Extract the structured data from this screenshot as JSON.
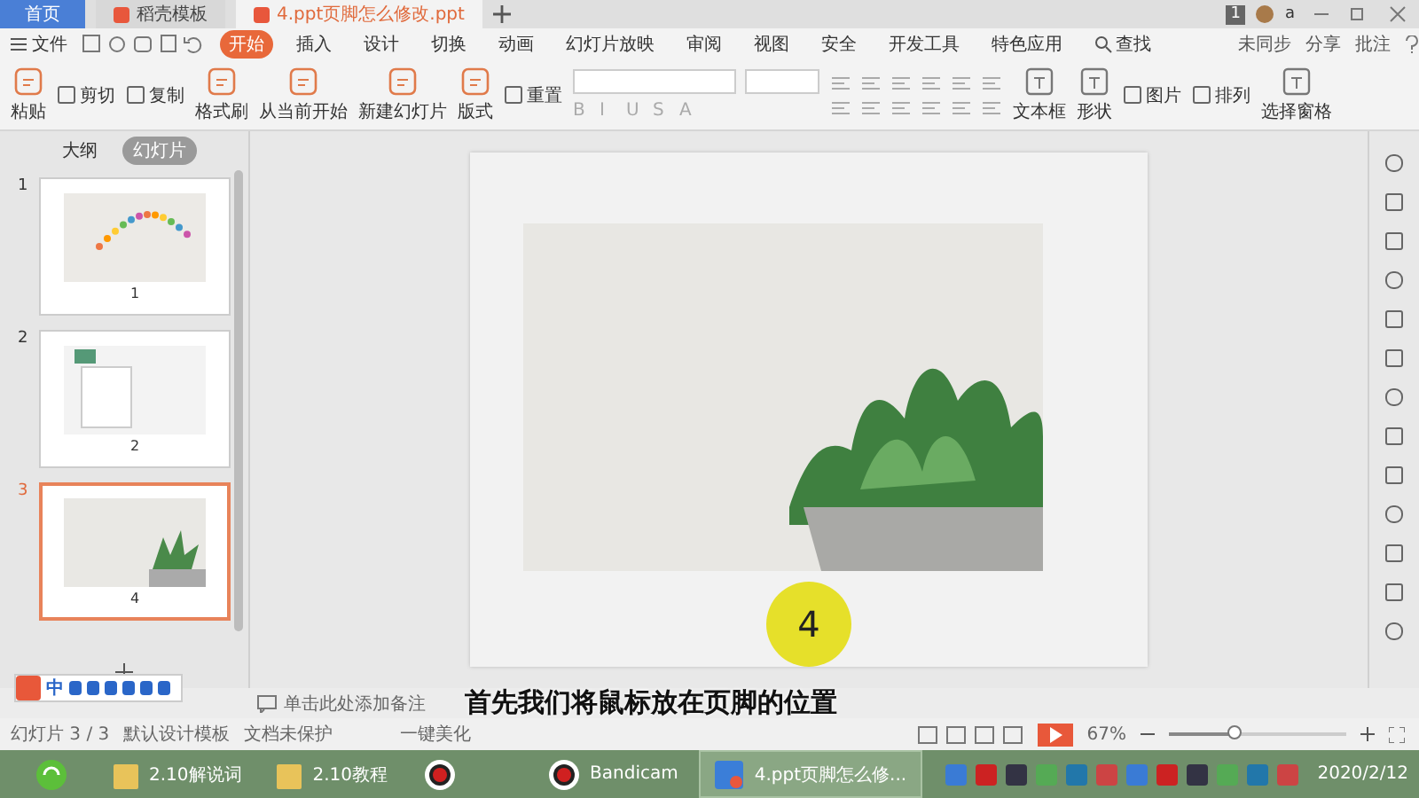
{
  "tabs": [
    {
      "label": "首页",
      "kind": "home",
      "selected": false
    },
    {
      "label": "稻壳模板",
      "kind": "template",
      "selected": false
    },
    {
      "label": "4.ppt页脚怎么修改.ppt",
      "kind": "document",
      "selected": true
    }
  ],
  "title_bar": {
    "badge": "1",
    "user": "a"
  },
  "menu": {
    "file": "文件",
    "items": [
      {
        "label": "开始",
        "selected": true
      },
      {
        "label": "插入",
        "selected": false
      },
      {
        "label": "设计",
        "selected": false
      },
      {
        "label": "切换",
        "selected": false
      },
      {
        "label": "动画",
        "selected": false
      },
      {
        "label": "幻灯片放映",
        "selected": false
      },
      {
        "label": "审阅",
        "selected": false
      },
      {
        "label": "视图",
        "selected": false
      },
      {
        "label": "安全",
        "selected": false
      },
      {
        "label": "开发工具",
        "selected": false
      },
      {
        "label": "特色应用",
        "selected": false
      }
    ],
    "search": "查找",
    "actions": [
      "未同步",
      "分享",
      "批注"
    ]
  },
  "ribbon": {
    "left": [
      {
        "label": "粘贴",
        "kind": "large"
      },
      {
        "label": "剪切",
        "kind": "small"
      },
      {
        "label": "复制",
        "kind": "small"
      },
      {
        "label": "格式刷",
        "kind": "large"
      },
      {
        "label": "从当前开始",
        "kind": "large"
      },
      {
        "label": "新建幻灯片",
        "kind": "large"
      },
      {
        "label": "版式",
        "kind": "large"
      },
      {
        "label": "重置",
        "kind": "small"
      }
    ],
    "format_buttons": [
      "B",
      "I",
      "U",
      "S",
      "A"
    ],
    "right": [
      {
        "label": "文本框",
        "kind": "large"
      },
      {
        "label": "形状",
        "kind": "large"
      },
      {
        "label": "图片",
        "kind": "small"
      },
      {
        "label": "排列",
        "kind": "small"
      },
      {
        "label": "选择窗格",
        "kind": "large"
      }
    ]
  },
  "panel": {
    "tabs": [
      {
        "label": "大纲",
        "selected": false
      },
      {
        "label": "幻灯片",
        "selected": true
      }
    ],
    "slides": [
      {
        "number": "1",
        "caption": "1",
        "kind": "dots",
        "selected": false
      },
      {
        "number": "2",
        "caption": "2",
        "kind": "notebook",
        "selected": false
      },
      {
        "number": "3",
        "caption": "4",
        "kind": "plant",
        "selected": true
      }
    ]
  },
  "slide": {
    "footer": "4"
  },
  "notes": {
    "text": "单击此处添加备注"
  },
  "status_bar": {
    "slide": "幻灯片 3 / 3",
    "template": "默认设计模板",
    "protection": "文档未保护",
    "beautify": "一键美化",
    "zoom": "67%",
    "level": 0.37
  },
  "ime": {
    "mode": "中"
  },
  "subtitle": "首先我们将鼠标放在页脚的位置",
  "taskbar": {
    "items": [
      {
        "label": "2.10解说词",
        "kind": "folder",
        "selected": false
      },
      {
        "label": "2.10教程",
        "kind": "folder",
        "selected": false
      },
      {
        "kind": "recorder",
        "selected": false
      },
      {
        "label": "Bandicam",
        "kind": "recorder",
        "selected": false
      },
      {
        "label": "4.ppt页脚怎么修...",
        "kind": "wps",
        "selected": true
      }
    ],
    "date": "2020/2/12"
  }
}
